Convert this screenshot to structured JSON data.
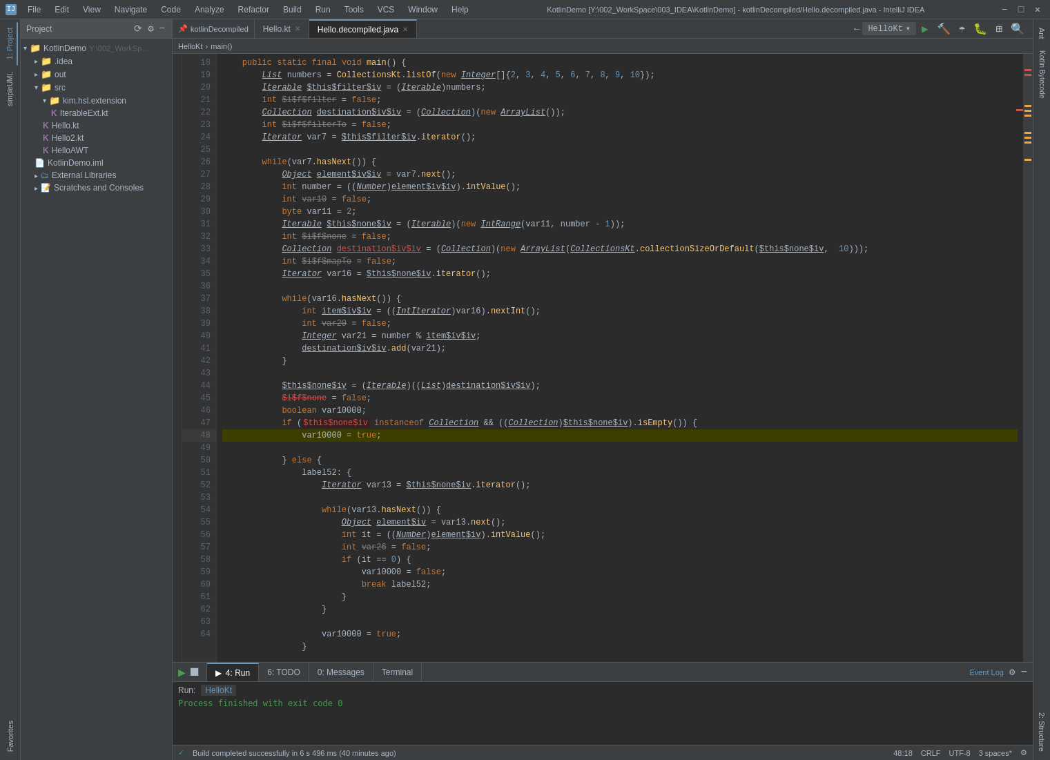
{
  "titleBar": {
    "title": "KotlinDemo [Y:\\002_WorkSpace\\003_IDEA\\KotlinDemo] - kotlinDecompiled/Hello.decompiled.java - IntelliJ IDEA",
    "icon": "IJ",
    "menus": [
      "File",
      "Edit",
      "View",
      "Navigate",
      "Code",
      "Analyze",
      "Refactor",
      "Build",
      "Run",
      "Tools",
      "VCS",
      "Window",
      "Help"
    ],
    "winBtns": [
      "−",
      "□",
      "✕"
    ]
  },
  "tabs": {
    "projectTab": "kotlinDecompiled",
    "file1": "Hello.kt",
    "file2": "Hello.decompiled.java",
    "pinIndicator": "📌"
  },
  "runConfig": {
    "name": "HelloKt",
    "dropdown": "▾"
  },
  "breadcrumb": {
    "parts": [
      "HelloKt",
      "›",
      "main()"
    ]
  },
  "projectPanel": {
    "title": "Project",
    "root": "KotlinDemo",
    "rootSuffix": "Y:\\002_WorkSp...",
    "items": [
      {
        "label": ".idea",
        "type": "folder",
        "depth": 1,
        "expanded": false
      },
      {
        "label": "out",
        "type": "folder",
        "depth": 1,
        "expanded": false
      },
      {
        "label": "src",
        "type": "folder",
        "depth": 1,
        "expanded": true
      },
      {
        "label": "kim.hsl.extension",
        "type": "folder",
        "depth": 2,
        "expanded": true
      },
      {
        "label": "IterableExt.kt",
        "type": "kt",
        "depth": 3
      },
      {
        "label": "Hello.kt",
        "type": "kt",
        "depth": 2
      },
      {
        "label": "Hello2.kt",
        "type": "kt",
        "depth": 2
      },
      {
        "label": "HelloAWT",
        "type": "kt",
        "depth": 2
      },
      {
        "label": "KotlinDemo.iml",
        "type": "iml",
        "depth": 1
      },
      {
        "label": "External Libraries",
        "type": "folder-special",
        "depth": 1,
        "expanded": false
      },
      {
        "label": "Scratches and Consoles",
        "type": "scratches",
        "depth": 1,
        "expanded": false
      }
    ]
  },
  "sidebar": {
    "left": [
      "1: Project",
      "2: ⚡ simpleUML",
      "3: Favorites"
    ],
    "right": [
      "Ant",
      "Kotlin Bytecode",
      "2: Structure"
    ]
  },
  "codeLines": [
    {
      "num": 18,
      "content": "    public static final void main() {",
      "type": "normal"
    },
    {
      "num": 19,
      "content": "        List numbers = CollectionsKt.listOf(new Integer[]{2, 3, 4, 5, 6, 7, 8, 9, 10});",
      "type": "normal"
    },
    {
      "num": 20,
      "content": "        Iterable $this$filter$iv = (Iterable)numbers;",
      "type": "normal"
    },
    {
      "num": 21,
      "content": "        int $i$f$filter = false;",
      "type": "normal"
    },
    {
      "num": 22,
      "content": "        Collection destination$iv$iv = (Collection)(new ArrayList());",
      "type": "normal"
    },
    {
      "num": 23,
      "content": "        int $i$f$filterTo = false;",
      "type": "normal"
    },
    {
      "num": 24,
      "content": "        Iterator var7 = $this$filter$iv.iterator();",
      "type": "normal"
    },
    {
      "num": 25,
      "content": "",
      "type": "normal"
    },
    {
      "num": 26,
      "content": "        while(var7.hasNext()) {",
      "type": "normal"
    },
    {
      "num": 27,
      "content": "            Object element$iv$iv = var7.next();",
      "type": "normal"
    },
    {
      "num": 28,
      "content": "            int number = ((Number)element$iv$iv).intValue();",
      "type": "normal"
    },
    {
      "num": 29,
      "content": "            int var10 = false;",
      "type": "normal"
    },
    {
      "num": 30,
      "content": "            byte var11 = 2;",
      "type": "normal"
    },
    {
      "num": 31,
      "content": "            Iterable $this$none$iv = (Iterable)(new IntRange(var11, number - 1));",
      "type": "normal"
    },
    {
      "num": 32,
      "content": "            int $i$f$none = false;",
      "type": "normal"
    },
    {
      "num": 33,
      "content": "            Collection destination$iv$iv = (Collection)(new ArrayList(CollectionsKt.collectionSizeOrDefault($this$none$iv, 10)));",
      "type": "normal"
    },
    {
      "num": 34,
      "content": "            int $i$f$mapTo = false;",
      "type": "normal"
    },
    {
      "num": 35,
      "content": "            Iterator var16 = $this$none$iv.iterator();",
      "type": "normal"
    },
    {
      "num": 36,
      "content": "",
      "type": "normal"
    },
    {
      "num": 37,
      "content": "            while(var16.hasNext()) {",
      "type": "normal"
    },
    {
      "num": 38,
      "content": "                int item$iv$iv = ((IntIterator)var16).nextInt();",
      "type": "normal"
    },
    {
      "num": 39,
      "content": "                int var20 = false;",
      "type": "normal"
    },
    {
      "num": 40,
      "content": "                Integer var21 = number % item$iv$iv;",
      "type": "normal"
    },
    {
      "num": 41,
      "content": "                destination$iv$iv.add(var21);",
      "type": "normal"
    },
    {
      "num": 42,
      "content": "            }",
      "type": "normal"
    },
    {
      "num": 43,
      "content": "",
      "type": "normal"
    },
    {
      "num": 44,
      "content": "            $this$none$iv = (Iterable)((List)destination$iv$iv);",
      "type": "normal"
    },
    {
      "num": 45,
      "content": "            $i$f$none = false;",
      "type": "strikethrough"
    },
    {
      "num": 46,
      "content": "            boolean var10000;",
      "type": "normal"
    },
    {
      "num": 47,
      "content": "            if ($this$none$iv instanceof Collection && ((Collection)$this$none$iv).isEmpty()) {",
      "type": "normal"
    },
    {
      "num": 48,
      "content": "                var10000 = true;",
      "type": "highlighted"
    },
    {
      "num": 49,
      "content": "            } else {",
      "type": "normal"
    },
    {
      "num": 50,
      "content": "                label52: {",
      "type": "normal"
    },
    {
      "num": 51,
      "content": "                    Iterator var13 = $this$none$iv.iterator();",
      "type": "normal"
    },
    {
      "num": 52,
      "content": "",
      "type": "normal"
    },
    {
      "num": 53,
      "content": "                    while(var13.hasNext()) {",
      "type": "normal"
    },
    {
      "num": 54,
      "content": "                        Object element$iv = var13.next();",
      "type": "normal"
    },
    {
      "num": 55,
      "content": "                        int it = ((Number)element$iv).intValue();",
      "type": "normal"
    },
    {
      "num": 56,
      "content": "                        int var26 = false;",
      "type": "normal"
    },
    {
      "num": 57,
      "content": "                        if (it == 0) {",
      "type": "normal"
    },
    {
      "num": 58,
      "content": "                            var10000 = false;",
      "type": "normal"
    },
    {
      "num": 59,
      "content": "                            break label52;",
      "type": "normal"
    },
    {
      "num": 60,
      "content": "                        }",
      "type": "normal"
    },
    {
      "num": 61,
      "content": "                    }",
      "type": "normal"
    },
    {
      "num": 62,
      "content": "",
      "type": "normal"
    },
    {
      "num": 63,
      "content": "                    var10000 = true;",
      "type": "normal"
    },
    {
      "num": 64,
      "content": "                }",
      "type": "normal"
    }
  ],
  "bottomPanel": {
    "runLabel": "Run:",
    "runTabName": "HelloKt",
    "outputText": "Process finished with exit code 0",
    "gearIcon": "⚙",
    "closeIcon": "−",
    "eventLogLabel": "Event Log",
    "tabs": [
      "4: Run",
      "6: TODO",
      "0: Messages",
      "Terminal"
    ]
  },
  "statusBar": {
    "buildStatus": "Build completed successfully in 6 s 496 ms (40 minutes ago)",
    "position": "48:18",
    "lineEnding": "CRLF",
    "encoding": "UTF-8",
    "indent": "3 spaces*",
    "checkIcon": "✓"
  },
  "colors": {
    "accent": "#6897bb",
    "keyword": "#cc7832",
    "string": "#6a8759",
    "number": "#6897bb",
    "comment": "#808080",
    "method": "#ffc66d",
    "highlight": "#3d3d00",
    "error": "#c75450",
    "success": "#499c54"
  }
}
